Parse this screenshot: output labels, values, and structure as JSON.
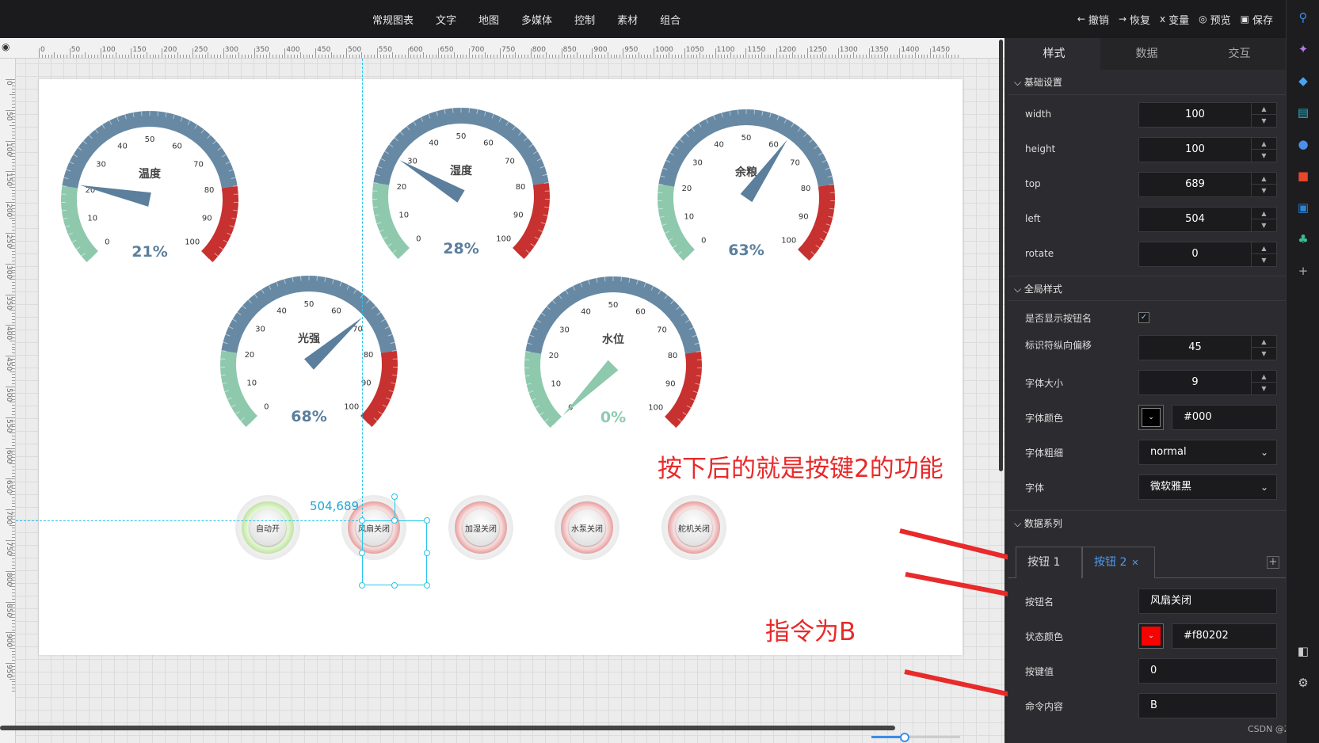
{
  "toolbar": {
    "nav": [
      "常规图表",
      "文字",
      "地图",
      "多媒体",
      "控制",
      "素材",
      "组合"
    ],
    "actions": [
      {
        "icon": "undo-arrow-icon",
        "glyph": "←",
        "label": "撤销"
      },
      {
        "icon": "redo-arrow-icon",
        "glyph": "→",
        "label": "恢复"
      },
      {
        "icon": "variable-icon",
        "glyph": "x",
        "label": "变量"
      },
      {
        "icon": "eye-icon",
        "glyph": "◎",
        "label": "预览"
      },
      {
        "icon": "save-icon",
        "glyph": "▣",
        "label": "保存"
      }
    ]
  },
  "rulers": {
    "h_labels": [
      "0",
      "50",
      "100",
      "150",
      "200",
      "250",
      "300",
      "350",
      "400",
      "450",
      "500",
      "550",
      "600",
      "650",
      "700",
      "750",
      "800",
      "850",
      "900",
      "950",
      "1000",
      "1050",
      "1100",
      "1150",
      "1200",
      "1250",
      "1300",
      "1350",
      "1400",
      "1450"
    ],
    "v_labels": [
      "0",
      "50",
      "100",
      "150",
      "200",
      "250",
      "300",
      "350",
      "400",
      "450",
      "500",
      "550",
      "600",
      "650",
      "700",
      "750",
      "800",
      "850",
      "900",
      "950"
    ]
  },
  "canvas": {
    "coord_label": "504,689",
    "gauges": [
      {
        "title": "温度",
        "value": "21%",
        "percent": 21,
        "value_color": "#5b7f9c",
        "ticks": [
          "0",
          "10",
          "20",
          "30",
          "40",
          "50",
          "60",
          "70",
          "80",
          "90",
          "100"
        ]
      },
      {
        "title": "湿度",
        "value": "28%",
        "percent": 28,
        "value_color": "#5b7f9c",
        "ticks": [
          "0",
          "10",
          "20",
          "30",
          "40",
          "50",
          "60",
          "70",
          "80",
          "90",
          "100"
        ]
      },
      {
        "title": "余粮",
        "value": "63%",
        "percent": 63,
        "value_color": "#5b7f9c",
        "ticks": [
          "0",
          "10",
          "20",
          "30",
          "40",
          "50",
          "60",
          "70",
          "80",
          "90",
          "100"
        ]
      },
      {
        "title": "光强",
        "value": "68%",
        "percent": 68,
        "value_color": "#5b7f9c",
        "ticks": [
          "0",
          "10",
          "20",
          "30",
          "40",
          "50",
          "60",
          "70",
          "80",
          "90",
          "100"
        ]
      },
      {
        "title": "水位",
        "value": "0%",
        "percent": 0,
        "value_color": "#8ccbb0",
        "ticks": [
          "0",
          "10",
          "20",
          "30",
          "40",
          "50",
          "60",
          "70",
          "80",
          "90",
          "100"
        ]
      }
    ],
    "colors": {
      "low": "#8ec9ad",
      "mid": "#6789a4",
      "high": "#c7312f",
      "needle": "#5b7f9c"
    },
    "buttons": [
      {
        "label": "自动开",
        "style": "green"
      },
      {
        "label": "风扇关闭",
        "style": "red"
      },
      {
        "label": "加湿关闭",
        "style": "red"
      },
      {
        "label": "水泵关闭",
        "style": "red"
      },
      {
        "label": "舵机关闭",
        "style": "red"
      }
    ],
    "annotations": {
      "a1": "按下后的就是按键2的功能",
      "a2": "指令为B"
    }
  },
  "panel": {
    "tabs": [
      "样式",
      "数据",
      "交互"
    ],
    "basic_section": "基础设置",
    "basic": [
      {
        "label": "width",
        "value": "100"
      },
      {
        "label": "height",
        "value": "100"
      },
      {
        "label": "top",
        "value": "689"
      },
      {
        "label": "left",
        "value": "504"
      },
      {
        "label": "rotate",
        "value": "0"
      }
    ],
    "global_section": "全局样式",
    "show_name_label": "是否显示按钮名",
    "show_name_checked": "✓",
    "offset_label": "标识符纵向偏移",
    "offset_value": "45",
    "font_size_label": "字体大小",
    "font_size_value": "9",
    "font_color_label": "字体颜色",
    "font_color_value": "#000",
    "font_weight_label": "字体粗细",
    "font_weight_value": "normal",
    "font_label": "字体",
    "font_value": "微软雅黑",
    "series_section": "数据系列",
    "series_tabs": [
      "按钮 1",
      "按钮 2"
    ],
    "button_name_label": "按钮名",
    "button_name_value": "风扇关闭",
    "state_color_label": "状态颜色",
    "state_color_value": "#f80202",
    "key_value_label": "按键值",
    "key_value_value": "0",
    "command_label": "命令内容",
    "command_value": "B"
  },
  "watermark": "CSDN @Zacyr"
}
